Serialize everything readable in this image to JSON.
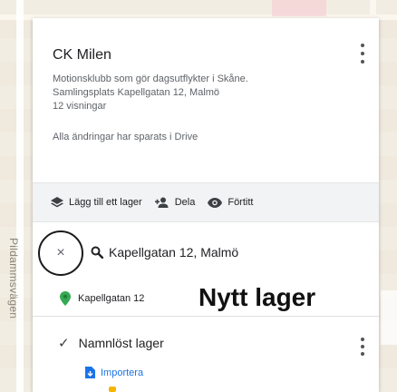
{
  "map": {
    "street_label": "Pildammsvägen"
  },
  "panel": {
    "title": "CK Milen",
    "description_line1": "Motionsklubb som gör dagsutflykter i Skåne.",
    "description_line2": "Samlingsplats  Kapellgatan 12, Malmö",
    "views": "12 visningar",
    "save_status": "Alla ändringar har sparats i Drive",
    "more_icon": "more-vert-icon"
  },
  "toolbar": {
    "add_layer": "Lägg till ett lager",
    "share": "Dela",
    "preview": "Förtitt"
  },
  "search_layer": {
    "close_glyph": "×",
    "query": "Kapellgatan 12, Malmö",
    "result": "Kapellgatan 12",
    "annotation": "Nytt lager",
    "pin_color": "#34a853"
  },
  "untitled_layer": {
    "check_glyph": "✓",
    "title": "Namnlöst lager",
    "import": "Importera",
    "import_color": "#1a73e8"
  }
}
